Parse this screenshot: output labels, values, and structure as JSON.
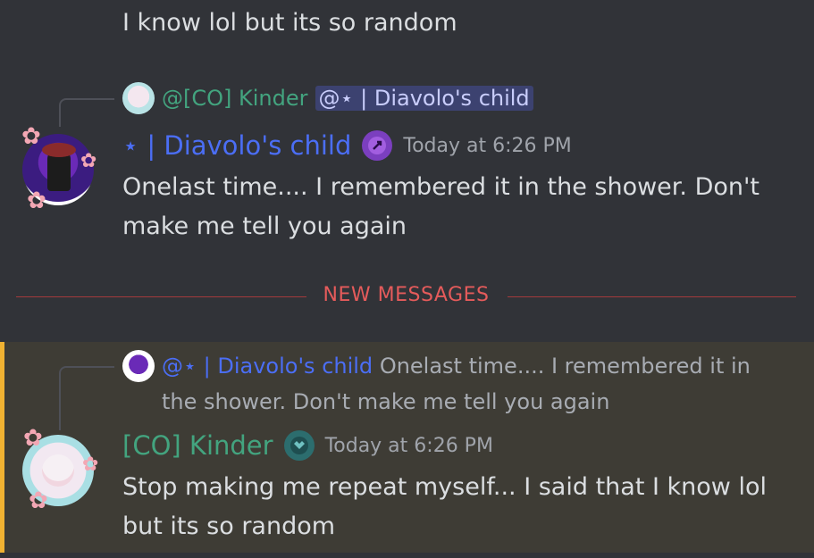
{
  "messages": {
    "previous": {
      "text": "I know lol but its so random"
    },
    "first": {
      "reply": {
        "author": "@[CO] Kinder",
        "mention": "@⋆ | Diavolo's child"
      },
      "author": "⋆ | Diavolo's child",
      "timestamp": "Today at 6:26 PM",
      "text": "Onelast time.... I remembered it in the shower. Don't make me tell you again"
    },
    "divider_label": "NEW MESSAGES",
    "second": {
      "reply": {
        "author": "@⋆ | Diavolo's child",
        "preview": "Onelast time.... I remembered it in the shower. Don't make me tell you again"
      },
      "author": "[CO] Kinder",
      "timestamp": "Today at 6:26 PM",
      "text": "Stop making me repeat myself... I said that I know lol but its so random"
    }
  },
  "colors": {
    "background": "#313338",
    "kinder_name": "#43a47f",
    "diavolo_name": "#4b6ef5",
    "new_messages": "#e55b5b",
    "mention_highlight": "#f0b232"
  },
  "icons": {
    "role_icon_first": "purple-rocket-badge-icon",
    "role_icon_second": "teal-emblem-badge-icon"
  }
}
